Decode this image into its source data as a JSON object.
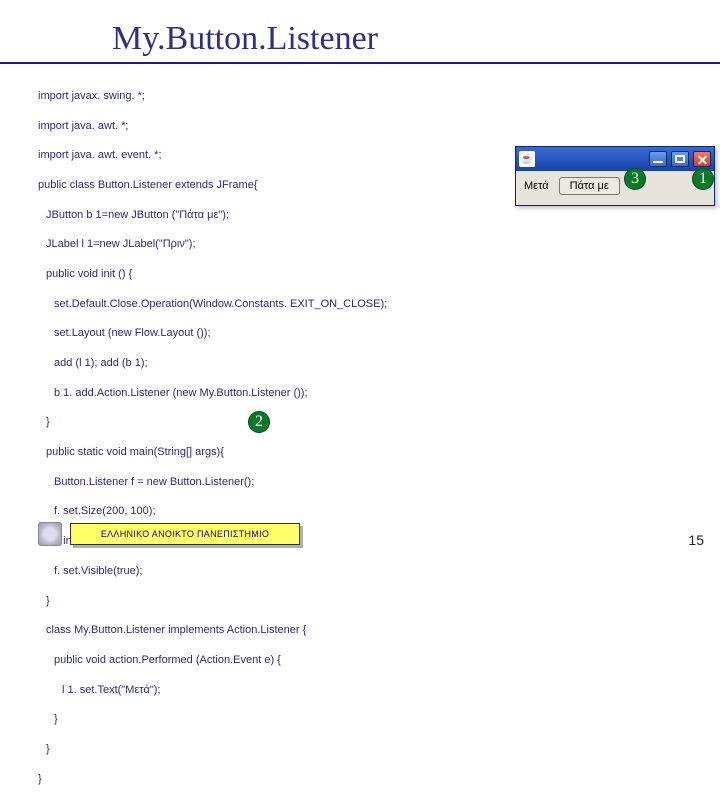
{
  "title": "My.Button.Listener",
  "code": {
    "l01": "import javax. swing. *;",
    "l02": "import java. awt. *;",
    "l03": "import java. awt. event. *;",
    "l04": "public class Button.Listener extends JFrame{",
    "l05": "JButton b 1=new JButton (\"Πάτα με\");",
    "l06": "JLabel l 1=new JLabel(\"Πριν\");",
    "l07": "public void init () {",
    "l08": "set.Default.Close.Operation(Window.Constants. EXIT_ON_CLOSE);",
    "l09": "set.Layout (new Flow.Layout ());",
    "l10": "add (l 1); add (b 1);",
    "l11": "b 1. add.Action.Listener (new My.Button.Listener ());",
    "l12": "}",
    "l13": "public static void main(String[] args){",
    "l14": "Button.Listener f = new Button.Listener();",
    "l15": "f. set.Size(200, 100);",
    "l16": "f. init();",
    "l17": "f. set.Visible(true);",
    "l18": "}",
    "l19": "class My.Button.Listener implements Action.Listener {",
    "l20": "public void action.Performed (Action.Event e) {",
    "l21": "l 1. set.Text(\"Μετά\");",
    "l22": "}",
    "l23": "}",
    "l24": "}"
  },
  "window": {
    "label": "Μετά",
    "button": "Πάτα με"
  },
  "circles": {
    "c1": "1",
    "c2": "2",
    "c3": "3"
  },
  "footer": {
    "label": "ΕΛΛΗΝΙΚΟ ΑΝΟΙΚΤΟ ΠΑΝΕΠΙΣΤΗΜΙΟ"
  },
  "page": "15"
}
